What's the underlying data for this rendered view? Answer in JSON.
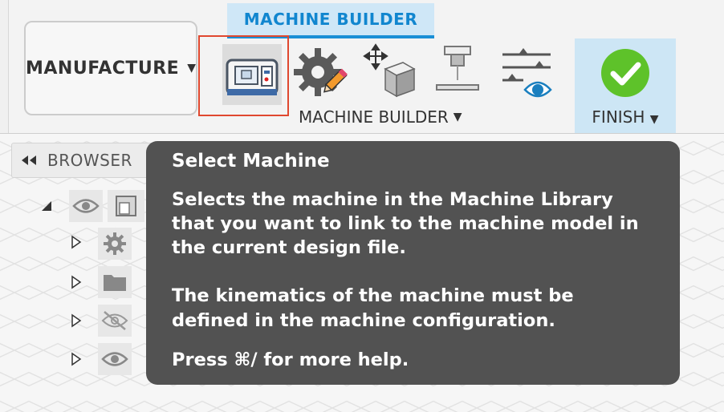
{
  "toolbar": {
    "workspace_label": "MANUFACTURE",
    "tab_label": "MACHINE BUILDER",
    "group_label": "MACHINE BUILDER",
    "finish_label": "FINISH",
    "icons": [
      "select-machine-icon",
      "machine-config-icon",
      "move-component-icon",
      "machine-axis-icon",
      "visibility-settings-icon",
      "finish-checkmark-icon"
    ],
    "colors": {
      "accent": "#1186cf",
      "highlight": "#e0482f",
      "finish_green": "#5ec22a"
    }
  },
  "browser": {
    "label": "BROWSER",
    "tree_icons": [
      "eye-icon",
      "component-icon",
      "gear-icon",
      "folder-icon",
      "eye-hidden-icon",
      "eye-icon"
    ]
  },
  "tooltip": {
    "title": "Select Machine",
    "body_lines": [
      "Selects the machine in the Machine Library",
      "that you want to link to the machine model in",
      "the current design file."
    ],
    "note_lines": [
      "The kinematics of the machine must be",
      "defined in the machine configuration."
    ],
    "help": "Press ⌘/ for more help."
  }
}
